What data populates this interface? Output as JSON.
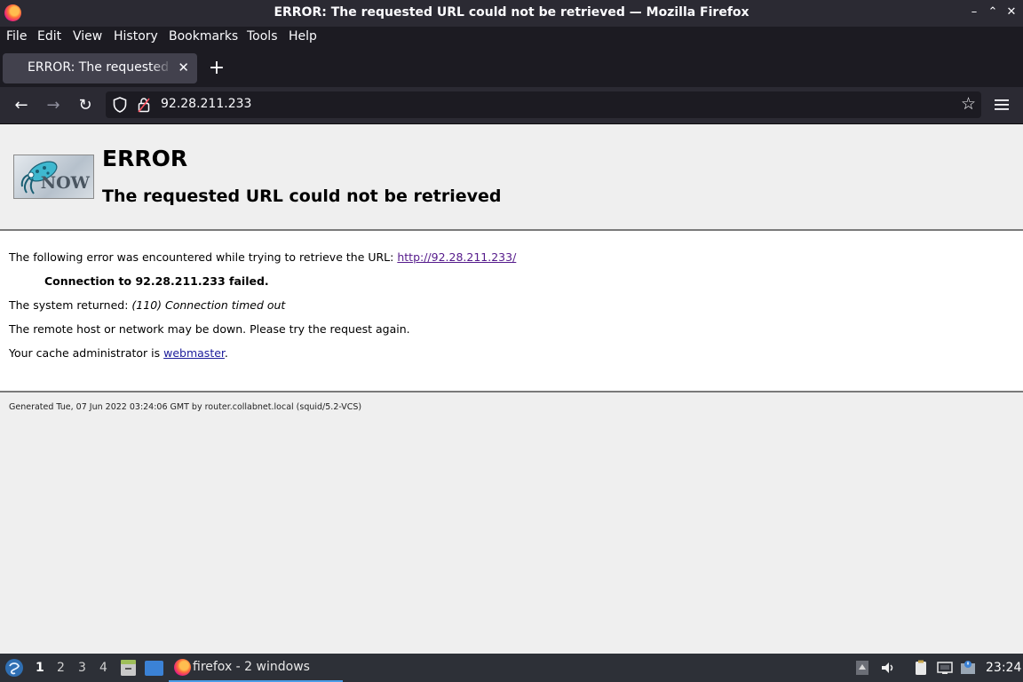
{
  "window": {
    "title": "ERROR: The requested URL could not be retrieved — Mozilla Firefox"
  },
  "menubar": {
    "items": [
      "File",
      "Edit",
      "View",
      "History",
      "Bookmarks",
      "Tools",
      "Help"
    ]
  },
  "tab": {
    "title": "ERROR: The requested URL could not be retrieved"
  },
  "urlbar": {
    "url": "92.28.211.233"
  },
  "page": {
    "h1": "ERROR",
    "h2": "The requested URL could not be retrieved",
    "logo_text": "NOW",
    "line1_text": "The following error was encountered while trying to retrieve the URL: ",
    "line1_link": "http://92.28.211.233/",
    "line2": "Connection to 92.28.211.233 failed.",
    "line3_text": "The system returned: ",
    "line3_em": "(110) Connection timed out",
    "line4": "The remote host or network may be down. Please try the request again.",
    "line5_text": "Your cache administrator is ",
    "line5_link": "webmaster",
    "line5_end": ".",
    "footer": "Generated Tue, 07 Jun 2022 03:24:06 GMT by router.collabnet.local (squid/5.2-VCS)"
  },
  "taskbar": {
    "workspaces": [
      "1",
      "2",
      "3",
      "4"
    ],
    "task_label": "firefox - 2 windows",
    "clock": "23:24"
  }
}
